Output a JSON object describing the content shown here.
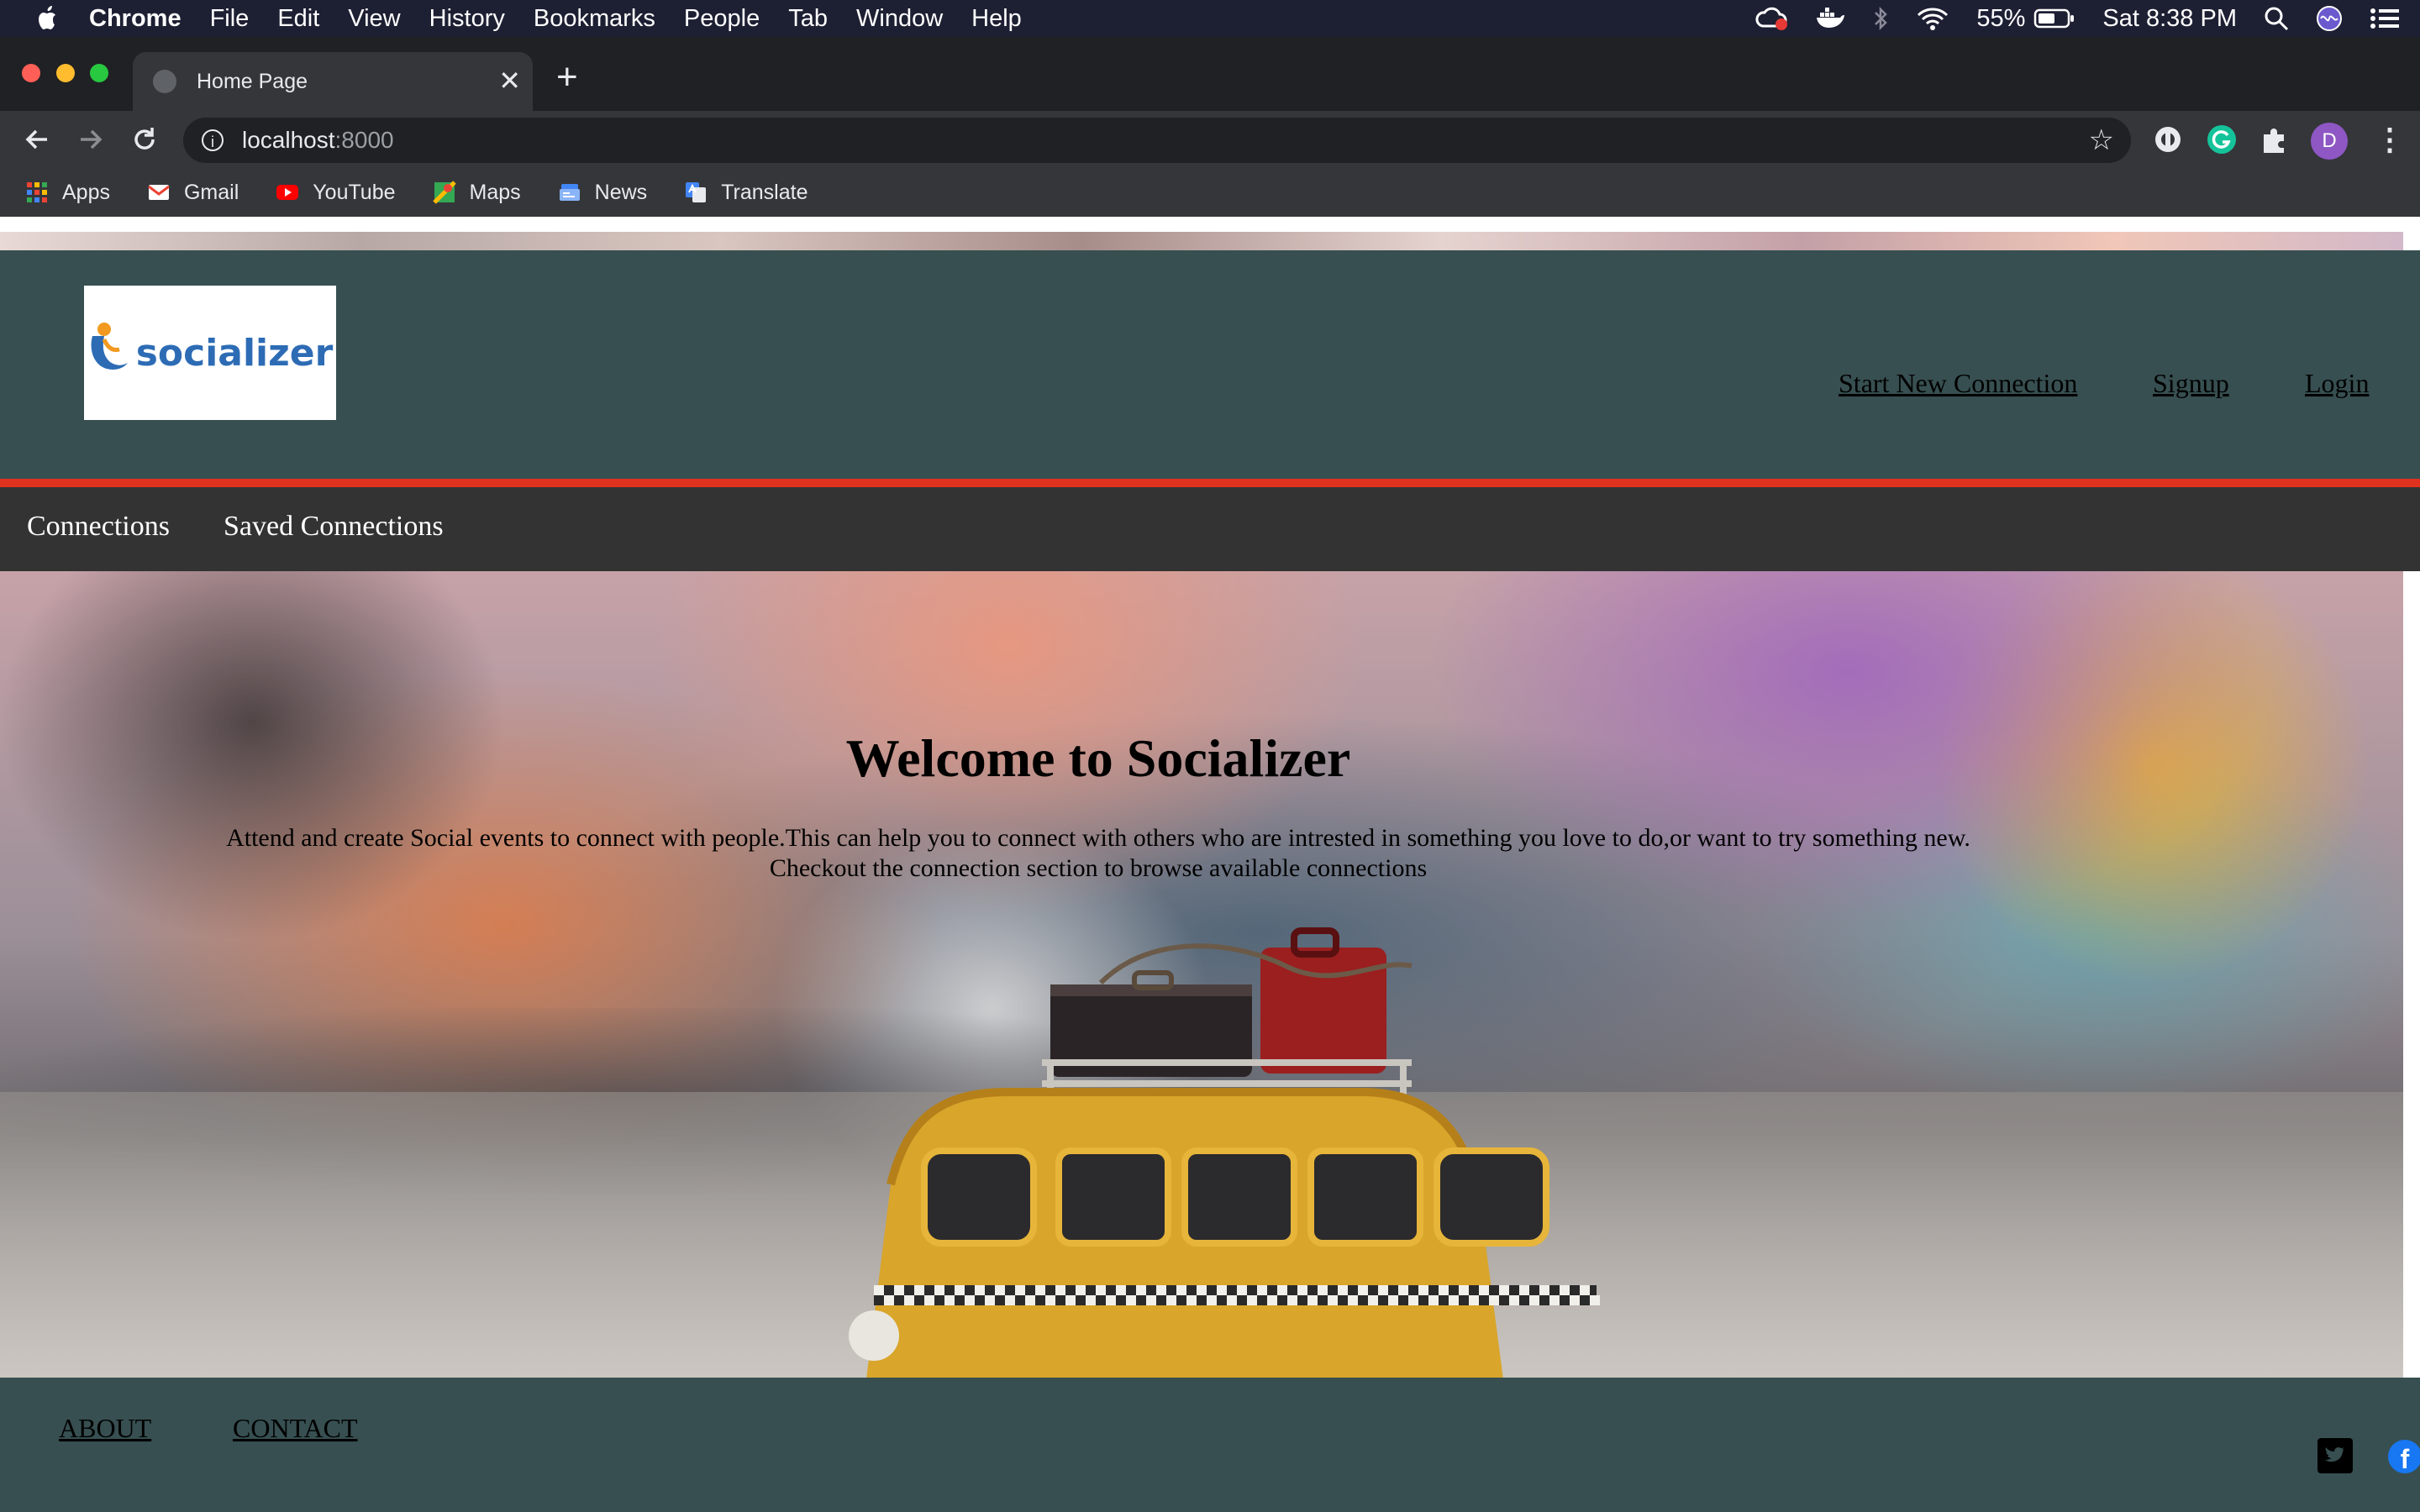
{
  "os_menubar": {
    "app_name": "Chrome",
    "menus": [
      "File",
      "Edit",
      "View",
      "History",
      "Bookmarks",
      "People",
      "Tab",
      "Window",
      "Help"
    ],
    "battery": "55%",
    "clock": "Sat 8:38 PM"
  },
  "browser": {
    "tab_title": "Home Page",
    "url_host": "localhost",
    "url_port": ":8000",
    "profile_initial": "D",
    "bookmarks": [
      "Apps",
      "Gmail",
      "YouTube",
      "Maps",
      "News",
      "Translate"
    ]
  },
  "site": {
    "logo_text": "socializer",
    "header_links": [
      "Start New Connection",
      "Signup",
      "Login"
    ],
    "subnav": [
      "Connections",
      "Saved Connections"
    ],
    "hero": {
      "title": "Welcome to Socializer",
      "description_line1": "Attend and create Social events to connect with people.This can help you to connect with others who are intrested in something you love to do,or want to try something new.",
      "description_line2": "Checkout the connection section to browse available connections"
    },
    "footer_links": [
      "ABOUT",
      "CONTACT"
    ]
  },
  "colors": {
    "header_bg": "#374f51",
    "accent_line": "#e0321f",
    "subnav_bg": "#333333",
    "logo_blue": "#2d6cb5"
  }
}
